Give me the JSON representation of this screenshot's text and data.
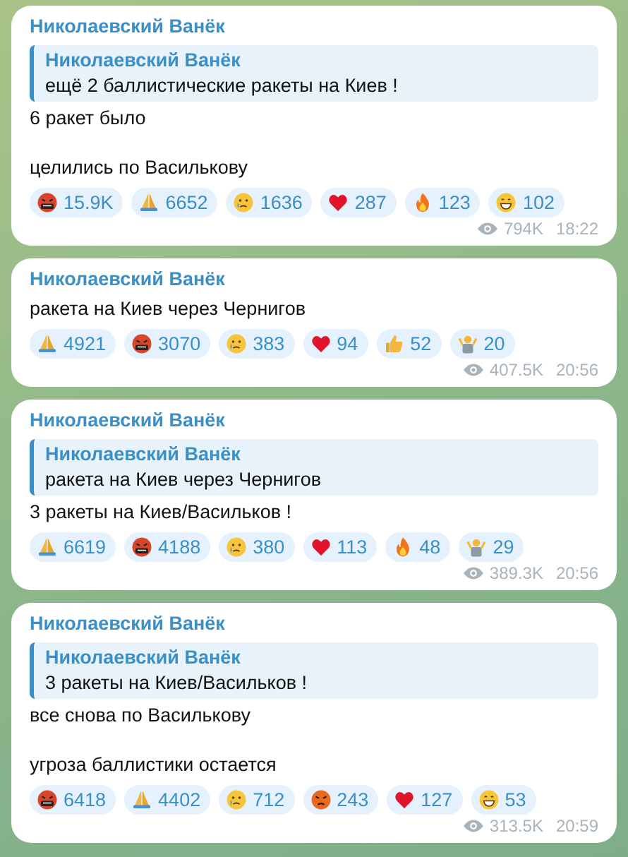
{
  "messages": [
    {
      "author": "Николаевский Ванёк",
      "reply": {
        "author": "Николаевский Ванёк",
        "text": "ещё 2 баллистические ракеты на Киев !"
      },
      "paragraphs": [
        "6 ракет было",
        "целились по Василькову"
      ],
      "reactions": [
        {
          "kind": "cursing",
          "count": "15.9K"
        },
        {
          "kind": "pray",
          "count": "6652"
        },
        {
          "kind": "cry",
          "count": "1636"
        },
        {
          "kind": "heart",
          "count": "287"
        },
        {
          "kind": "fire",
          "count": "123"
        },
        {
          "kind": "grin",
          "count": "102"
        }
      ],
      "views": "794K",
      "time": "18:22"
    },
    {
      "author": "Николаевский Ванёк",
      "paragraphs": [
        "ракета на Киев через Чернигов"
      ],
      "reactions": [
        {
          "kind": "pray",
          "count": "4921"
        },
        {
          "kind": "cursing",
          "count": "3070"
        },
        {
          "kind": "cry",
          "count": "383"
        },
        {
          "kind": "heart",
          "count": "94"
        },
        {
          "kind": "thumbs",
          "count": "52"
        },
        {
          "kind": "shrug",
          "count": "20"
        }
      ],
      "views": "407.5K",
      "time": "20:56"
    },
    {
      "author": "Николаевский Ванёк",
      "reply": {
        "author": "Николаевский Ванёк",
        "text": "ракета на Киев через Чернигов"
      },
      "paragraphs": [
        "3 ракеты на Киев/Васильков !"
      ],
      "reactions": [
        {
          "kind": "pray",
          "count": "6619"
        },
        {
          "kind": "cursing",
          "count": "4188"
        },
        {
          "kind": "cry",
          "count": "380"
        },
        {
          "kind": "heart",
          "count": "113"
        },
        {
          "kind": "fire",
          "count": "48"
        },
        {
          "kind": "shrug",
          "count": "29"
        }
      ],
      "views": "389.3K",
      "time": "20:56"
    },
    {
      "author": "Николаевский Ванёк",
      "reply": {
        "author": "Николаевский Ванёк",
        "text": "3 ракеты на Киев/Васильков !"
      },
      "paragraphs": [
        "все снова по Василькову",
        "угроза баллистики остается"
      ],
      "reactions": [
        {
          "kind": "cursing",
          "count": "6418"
        },
        {
          "kind": "pray",
          "count": "4402"
        },
        {
          "kind": "cry",
          "count": "712"
        },
        {
          "kind": "angry",
          "count": "243"
        },
        {
          "kind": "heart",
          "count": "127"
        },
        {
          "kind": "grin",
          "count": "53"
        }
      ],
      "views": "313.5K",
      "time": "20:59"
    }
  ]
}
